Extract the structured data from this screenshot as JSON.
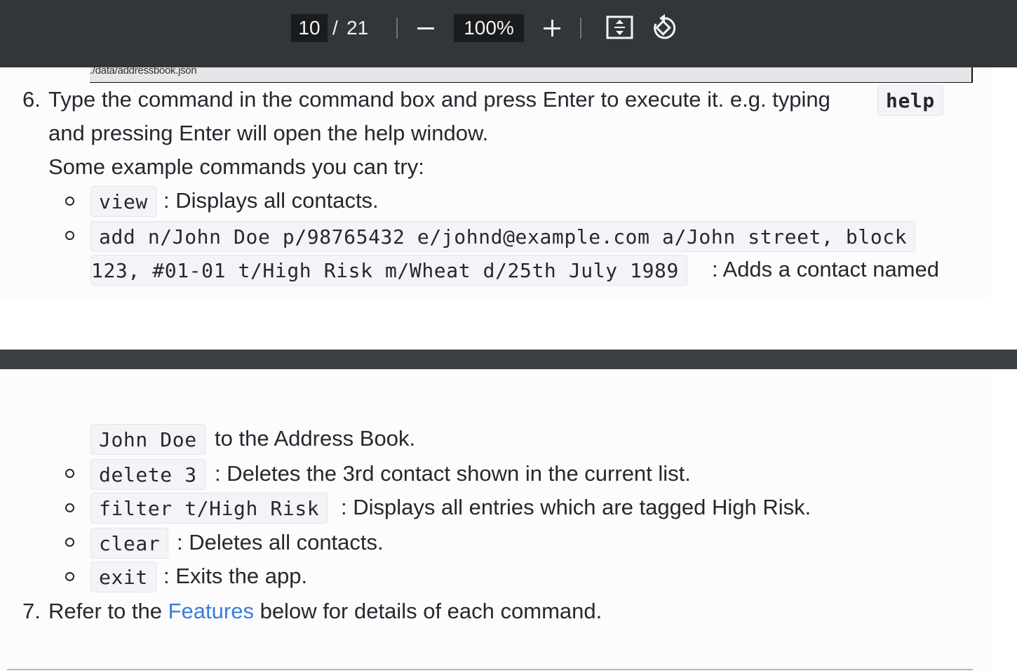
{
  "toolbar": {
    "page_current": "10",
    "page_separator": "/",
    "page_total": "21",
    "zoom_value": "100%"
  },
  "content": {
    "code_strip": "./data/addressbook.json",
    "step6": {
      "number": "6.",
      "line1_text": "Type the command in the command box and press Enter to execute it. e.g. typing",
      "line1_code": "help",
      "line2": "and pressing Enter will open the help window.",
      "line3": "Some example commands you can try:"
    },
    "examples": [
      {
        "code": "view",
        "desc": ": Displays all contacts."
      },
      {
        "code_line1": "add n/John Doe p/98765432 e/johnd@example.com a/John street, block",
        "code_line2": "123, #01-01 t/High Risk m/Wheat d/25th July 1989",
        "desc_line1": ": Adds a contact named",
        "desc_code": "John Doe",
        "desc_line2": "to the Address Book."
      },
      {
        "code": "delete 3",
        "desc": ": Deletes the 3rd contact shown in the current list."
      },
      {
        "code": "filter t/High Risk",
        "desc": ": Displays all entries which are tagged High Risk."
      },
      {
        "code": "clear",
        "desc": ": Deletes all contacts."
      },
      {
        "code": "exit",
        "desc": ": Exits the app."
      }
    ],
    "step7": {
      "number": "7.",
      "before": "Refer to the",
      "link": "Features",
      "after": "below for details of each command."
    }
  }
}
